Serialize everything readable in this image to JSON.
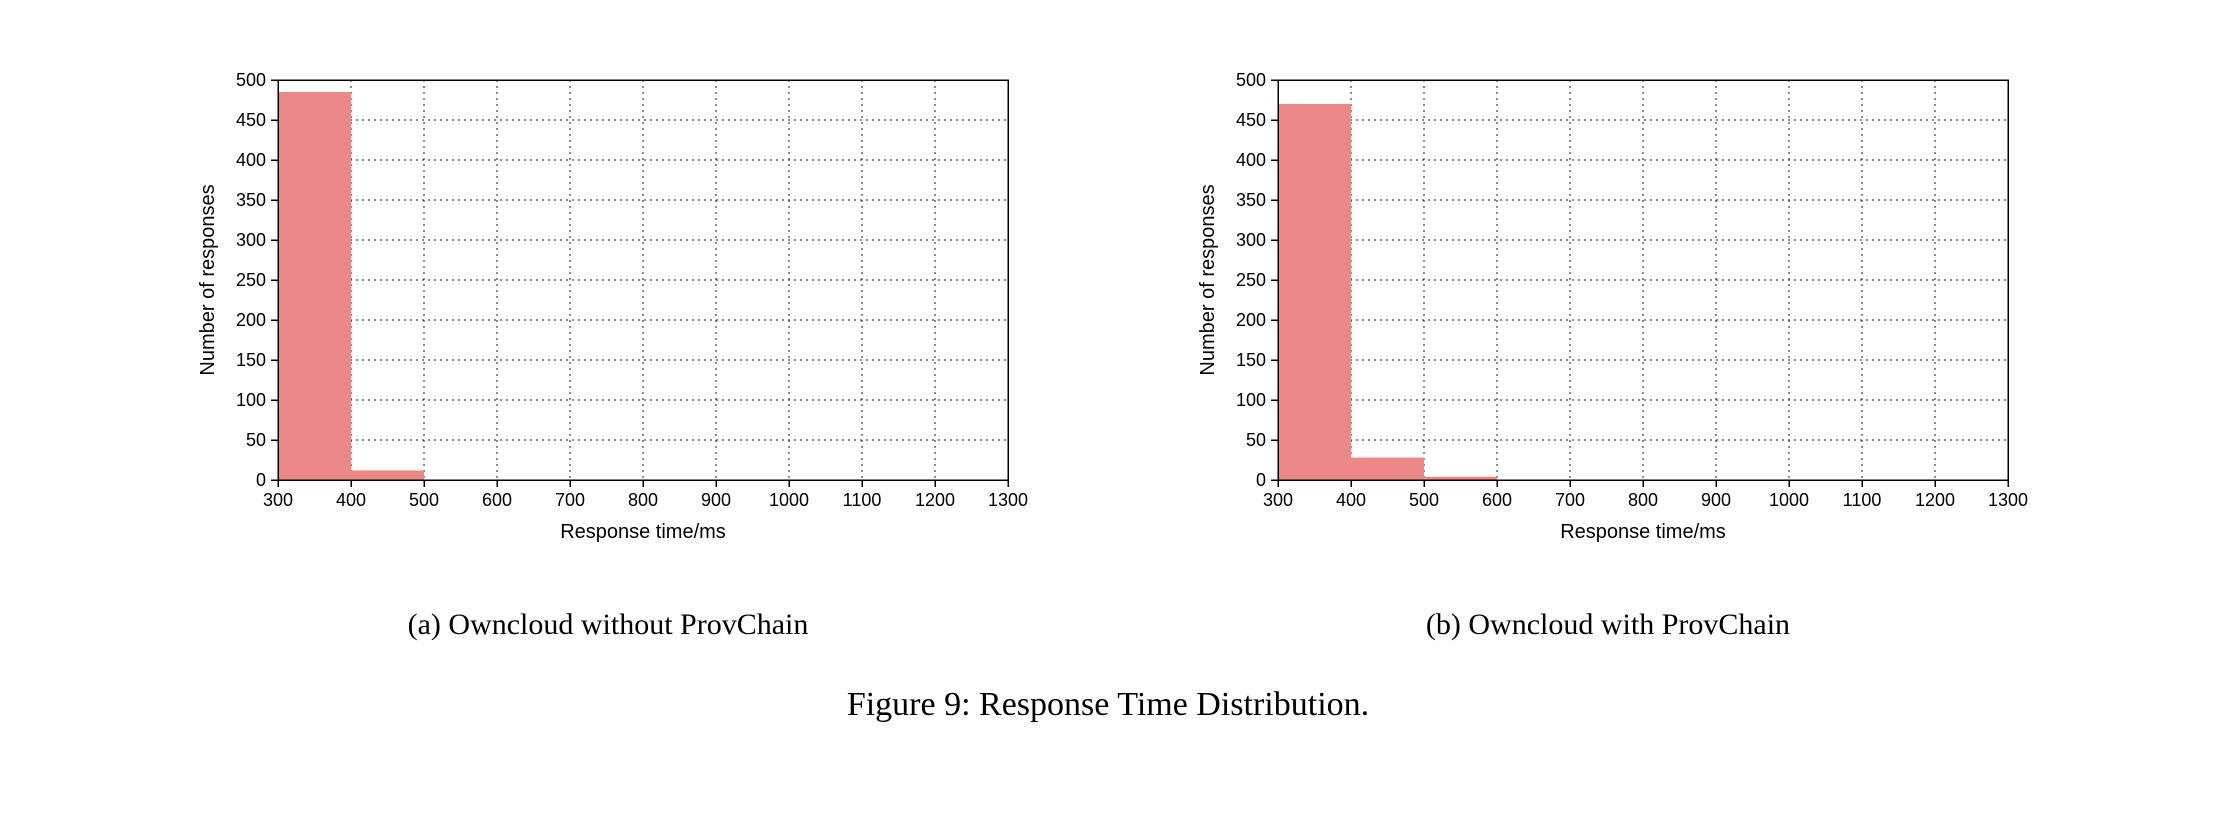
{
  "figure": {
    "main_caption": "Figure 9: Response Time Distribution.",
    "subcaptions": {
      "a": "(a) Owncloud without ProvChain",
      "b": "(b) Owncloud with ProvChain"
    }
  },
  "colors": {
    "bar_fill": "#ec8887",
    "axis": "#000000"
  },
  "chart_data": [
    {
      "id": "chart-a",
      "type": "bar",
      "title": "",
      "xlabel": "Response time/ms",
      "ylabel": "Number of responses",
      "xlim": [
        300,
        1300
      ],
      "ylim": [
        0,
        500
      ],
      "x_ticks": [
        300,
        400,
        500,
        600,
        700,
        800,
        900,
        1000,
        1100,
        1200,
        1300
      ],
      "y_ticks": [
        0,
        50,
        100,
        150,
        200,
        250,
        300,
        350,
        400,
        450,
        500
      ],
      "bin_width": 100,
      "categories": [
        300,
        400,
        500,
        600,
        700,
        800,
        900,
        1000,
        1100,
        1200
      ],
      "values": [
        485,
        12,
        0,
        0,
        0,
        0,
        0,
        0,
        0,
        0
      ]
    },
    {
      "id": "chart-b",
      "type": "bar",
      "title": "",
      "xlabel": "Response time/ms",
      "ylabel": "Number of responses",
      "xlim": [
        300,
        1300
      ],
      "ylim": [
        0,
        500
      ],
      "x_ticks": [
        300,
        400,
        500,
        600,
        700,
        800,
        900,
        1000,
        1100,
        1200,
        1300
      ],
      "y_ticks": [
        0,
        50,
        100,
        150,
        200,
        250,
        300,
        350,
        400,
        450,
        500
      ],
      "bin_width": 100,
      "categories": [
        300,
        400,
        500,
        600,
        700,
        800,
        900,
        1000,
        1100,
        1200
      ],
      "values": [
        470,
        28,
        4,
        0,
        0,
        0,
        0,
        0,
        0,
        0
      ]
    }
  ]
}
